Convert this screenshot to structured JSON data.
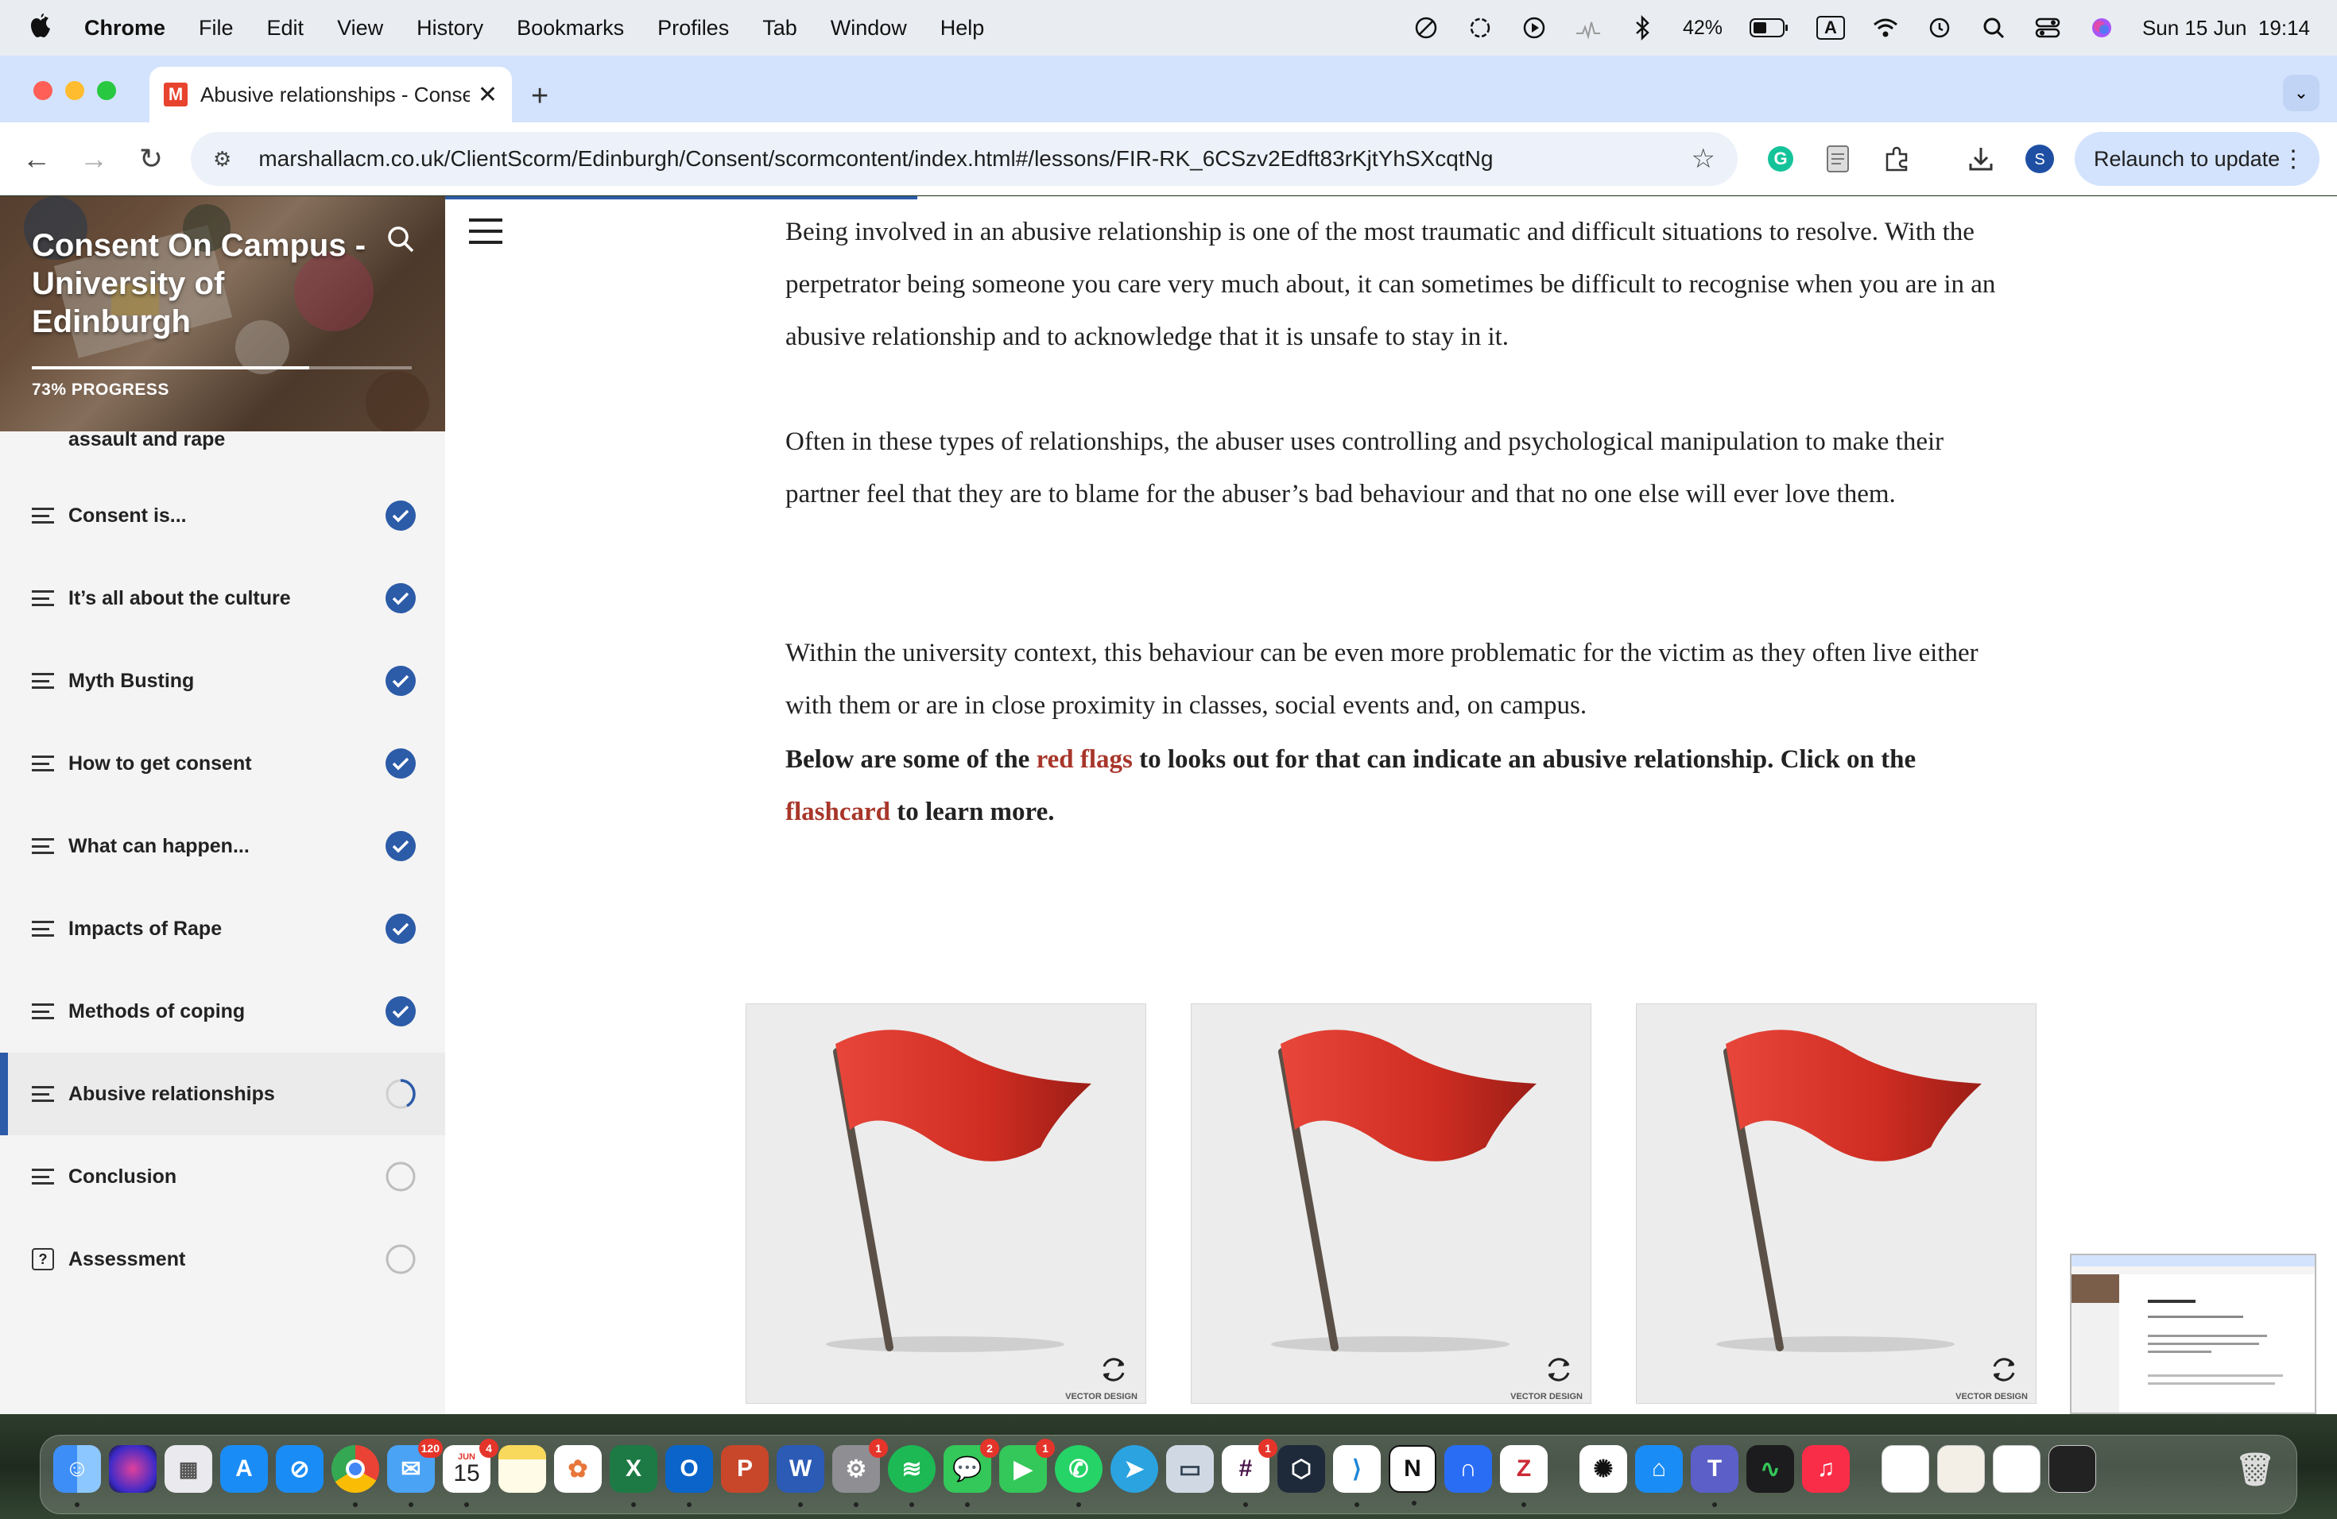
{
  "menubar": {
    "app_name": "Chrome",
    "items": [
      "File",
      "Edit",
      "View",
      "History",
      "Bookmarks",
      "Profiles",
      "Tab",
      "Window",
      "Help"
    ],
    "battery": "42%",
    "input_source": "A",
    "datetime": "Sun 15 Jun  19:14"
  },
  "browser": {
    "tab_favicon": "M",
    "tab_title": "Abusive relationships - Conse",
    "url": "marshallacm.co.uk/ClientScorm/Edinburgh/Consent/scormcontent/index.html#/lessons/FIR-RK_6CSzv2Edft83rKjtYhSXcqtNg",
    "profile_initial": "S",
    "relaunch_label": "Relaunch to update"
  },
  "sidebar": {
    "course_title": "Consent On Campus - University of Edinburgh",
    "progress_percent": 73,
    "progress_label": "73% PROGRESS",
    "partial_item_label": "assault and rape",
    "lessons": [
      {
        "label": "Consent is...",
        "status": "complete"
      },
      {
        "label": "It’s all about the culture",
        "status": "complete"
      },
      {
        "label": "Myth Busting",
        "status": "complete"
      },
      {
        "label": "How to get consent",
        "status": "complete"
      },
      {
        "label": "What can happen...",
        "status": "complete"
      },
      {
        "label": "Impacts of Rape",
        "status": "complete"
      },
      {
        "label": "Methods of coping",
        "status": "complete"
      },
      {
        "label": "Abusive relationships",
        "status": "in-progress"
      },
      {
        "label": "Conclusion",
        "status": "not-started"
      },
      {
        "label": "Assessment",
        "status": "not-started"
      }
    ]
  },
  "content": {
    "para1": "Being involved in an abusive relationship is one of the most traumatic and difficult situations to resolve. With the perpetrator being someone you care very much about, it can sometimes be difficult to recognise when you are in an abusive relationship and to acknowledge that it is unsafe to stay in it.",
    "para2": "Often in these types of relationships, the abuser uses controlling and psychological manipulation to make their partner feel that they are to blame for the abuser’s bad behaviour and that no one else will ever love them.",
    "para3": "Within the university context, this behaviour can be even more problematic for the victim as they often live either with them or are in close proximity in classes, social events and, on campus.",
    "para4_a": "Below are some of the ",
    "para4_red1": "red flags",
    "para4_b": " to looks out for that can indicate an abusive relationship. Click on the ",
    "para4_red2": "flashcard",
    "para4_c": " to learn more.",
    "card_credit": "VECTOR DESIGN"
  },
  "dock": {
    "mail_badge": "120",
    "calendar_month": "JUN",
    "calendar_day": "15",
    "calendar_badge": "4",
    "settings_badge": "1",
    "messages_badge": "2",
    "facetime_badge": "1",
    "slack_badge": "1"
  },
  "colors": {
    "accent": "#2c5ba8",
    "link_red": "#a8362a",
    "flag_red": "#d93a2b"
  }
}
